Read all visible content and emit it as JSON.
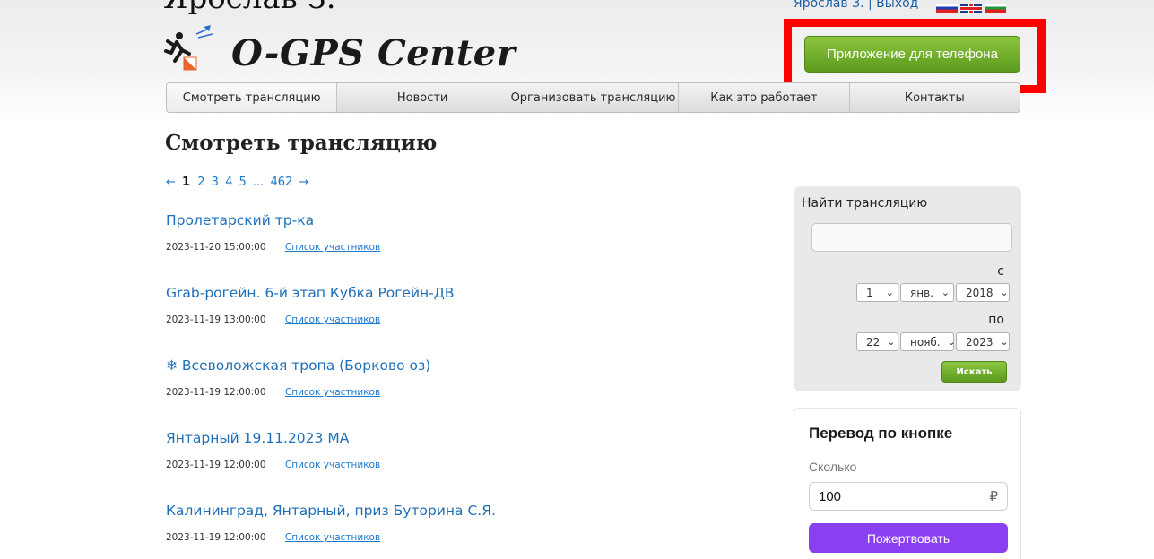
{
  "header": {
    "cropped_top_text": "Ярослав З.",
    "user_name": "Ярослав З.",
    "user_sep": "|",
    "logout": "Выход",
    "logo_text": "O-GPS Center",
    "app_button": "Приложение для телефона"
  },
  "nav": {
    "items": [
      {
        "label": "Смотреть трансляцию"
      },
      {
        "label": "Новости"
      },
      {
        "label": "Организовать трансляцию"
      },
      {
        "label": "Как это работает"
      },
      {
        "label": "Контакты"
      }
    ]
  },
  "main": {
    "title": "Смотреть трансляцию",
    "pagination": {
      "prev": "←",
      "current": "1",
      "pages": [
        "2",
        "3",
        "4",
        "5"
      ],
      "ellipsis": "...",
      "last": "462",
      "next": "→"
    },
    "events": [
      {
        "title": "Пролетарский тр-ка",
        "datetime": "2023-11-20 15:00:00",
        "link": "Список участников"
      },
      {
        "title": "Grab-рогейн. 6-й этап Кубка Рогейн-ДВ",
        "datetime": "2023-11-19 13:00:00",
        "link": "Список участников"
      },
      {
        "title": "❄ Всеволожская тропа (Борково оз)",
        "datetime": "2023-11-19 12:00:00",
        "link": "Список участников"
      },
      {
        "title": "Янтарный 19.11.2023 МА",
        "datetime": "2023-11-19 12:00:00",
        "link": "Список участников"
      },
      {
        "title": "Калининград, Янтарный, приз Буторина С.Я.",
        "datetime": "2023-11-19 12:00:00",
        "link": "Список участников"
      }
    ]
  },
  "search": {
    "title": "Найти трансляцию",
    "from_label": "с",
    "to_label": "по",
    "from": {
      "day": "1",
      "month": "янв.",
      "year": "2018"
    },
    "to": {
      "day": "22",
      "month": "нояб.",
      "year": "2023"
    },
    "button": "Искать"
  },
  "donate": {
    "title": "Перевод по кнопке",
    "amount_label": "Сколько",
    "amount": "100",
    "currency": "₽",
    "button": "Пожертвовать"
  },
  "colors": {
    "link": "#1f6fb8",
    "green_button": "#6fae2b",
    "donate_button": "#8a3ff0",
    "highlight": "#ff0000"
  }
}
